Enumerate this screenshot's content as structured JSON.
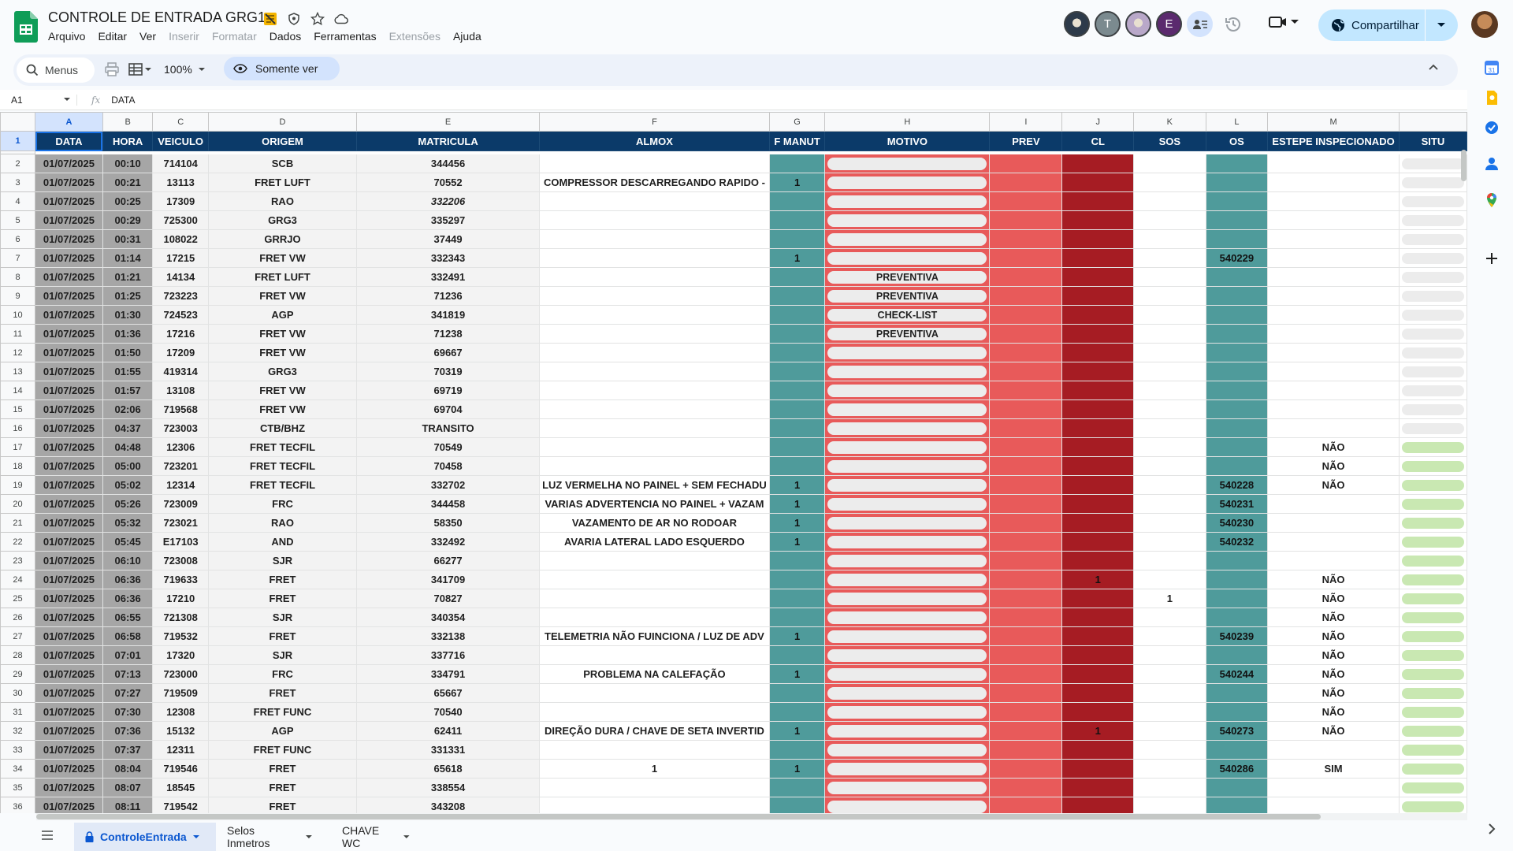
{
  "doc": {
    "title": "CONTROLE DE ENTRADA GRG1",
    "menus": [
      {
        "label": "Arquivo",
        "disabled": false
      },
      {
        "label": "Editar",
        "disabled": false
      },
      {
        "label": "Ver",
        "disabled": false
      },
      {
        "label": "Inserir",
        "disabled": true
      },
      {
        "label": "Formatar",
        "disabled": true
      },
      {
        "label": "Dados",
        "disabled": false
      },
      {
        "label": "Ferramentas",
        "disabled": false
      },
      {
        "label": "Extensões",
        "disabled": true
      },
      {
        "label": "Ajuda",
        "disabled": false
      }
    ]
  },
  "collaborators": [
    {
      "initial": "",
      "color": "#2d3a4a",
      "icon": "photo"
    },
    {
      "initial": "T",
      "color": "#7b8a8f",
      "icon": "letter"
    },
    {
      "initial": "",
      "color": "#b9a8c9",
      "icon": "photo"
    },
    {
      "initial": "E",
      "color": "#5b2a6e",
      "icon": "letter"
    },
    {
      "initial": "",
      "color": "#d3e3fd",
      "icon": "more"
    }
  ],
  "share": {
    "label": "Compartilhar"
  },
  "toolbar": {
    "search_label": "Menus",
    "zoom": "100%",
    "view_only_label": "Somente ver"
  },
  "formula": {
    "cell_ref": "A1",
    "fx": "fx",
    "content": "DATA"
  },
  "columns": [
    "A",
    "B",
    "C",
    "D",
    "E",
    "F",
    "G",
    "H",
    "I",
    "J",
    "K",
    "L",
    "M"
  ],
  "headers": [
    "DATA",
    "HORA",
    "VEICULO",
    "ORIGEM",
    "MATRICULA",
    "ALMOX",
    "F MANUT",
    "MOTIVO",
    "PREV",
    "CL",
    "SOS",
    "OS",
    "ESTEPE INSPECIONADO",
    "SITU"
  ],
  "rows": [
    {
      "n": "2",
      "data": "01/07/2025",
      "hora": "00:10",
      "veiculo": "714104",
      "origem": "SCB",
      "matricula": "344456",
      "almox": "",
      "fmanut": "",
      "motivo": "",
      "cl": "",
      "sos": "",
      "os": "",
      "estepe": "",
      "situ": "gray"
    },
    {
      "n": "3",
      "data": "01/07/2025",
      "hora": "00:21",
      "veiculo": "13113",
      "origem": "FRET LUFT",
      "matricula": "70552",
      "almox": "COMPRESSOR DESCARREGANDO RAPIDO -",
      "fmanut": "1",
      "motivo": "",
      "cl": "",
      "sos": "",
      "os": "",
      "estepe": "",
      "situ": "gray"
    },
    {
      "n": "4",
      "data": "01/07/2025",
      "hora": "00:25",
      "veiculo": "17309",
      "origem": "RAO",
      "matricula": "332206",
      "almox": "",
      "fmanut": "",
      "motivo": "",
      "cl": "",
      "sos": "",
      "os": "",
      "estepe": "",
      "situ": "gray",
      "italic": true
    },
    {
      "n": "5",
      "data": "01/07/2025",
      "hora": "00:29",
      "veiculo": "725300",
      "origem": "GRG3",
      "matricula": "335297",
      "almox": "",
      "fmanut": "",
      "motivo": "",
      "cl": "",
      "sos": "",
      "os": "",
      "estepe": "",
      "situ": "gray"
    },
    {
      "n": "6",
      "data": "01/07/2025",
      "hora": "00:31",
      "veiculo": "108022",
      "origem": "GRRJO",
      "matricula": "37449",
      "almox": "",
      "fmanut": "",
      "motivo": "",
      "cl": "",
      "sos": "",
      "os": "",
      "estepe": "",
      "situ": "gray"
    },
    {
      "n": "7",
      "data": "01/07/2025",
      "hora": "01:14",
      "veiculo": "17215",
      "origem": "FRET VW",
      "matricula": "332343",
      "almox": "",
      "fmanut": "1",
      "motivo": "",
      "cl": "",
      "sos": "",
      "os": "540229",
      "estepe": "",
      "situ": "gray"
    },
    {
      "n": "8",
      "data": "01/07/2025",
      "hora": "01:21",
      "veiculo": "14134",
      "origem": "FRET LUFT",
      "matricula": "332491",
      "almox": "",
      "fmanut": "",
      "motivo": "PREVENTIVA",
      "cl": "",
      "sos": "",
      "os": "",
      "estepe": "",
      "situ": "gray"
    },
    {
      "n": "9",
      "data": "01/07/2025",
      "hora": "01:25",
      "veiculo": "723223",
      "origem": "FRET VW",
      "matricula": "71236",
      "almox": "",
      "fmanut": "",
      "motivo": "PREVENTIVA",
      "cl": "",
      "sos": "",
      "os": "",
      "estepe": "",
      "situ": "gray"
    },
    {
      "n": "10",
      "data": "01/07/2025",
      "hora": "01:30",
      "veiculo": "724523",
      "origem": "AGP",
      "matricula": "341819",
      "almox": "",
      "fmanut": "",
      "motivo": "CHECK-LIST",
      "cl": "",
      "sos": "",
      "os": "",
      "estepe": "",
      "situ": "gray"
    },
    {
      "n": "11",
      "data": "01/07/2025",
      "hora": "01:36",
      "veiculo": "17216",
      "origem": "FRET VW",
      "matricula": "71238",
      "almox": "",
      "fmanut": "",
      "motivo": "PREVENTIVA",
      "cl": "",
      "sos": "",
      "os": "",
      "estepe": "",
      "situ": "gray"
    },
    {
      "n": "12",
      "data": "01/07/2025",
      "hora": "01:50",
      "veiculo": "17209",
      "origem": "FRET VW",
      "matricula": "69667",
      "almox": "",
      "fmanut": "",
      "motivo": "",
      "cl": "",
      "sos": "",
      "os": "",
      "estepe": "",
      "situ": "gray"
    },
    {
      "n": "13",
      "data": "01/07/2025",
      "hora": "01:55",
      "veiculo": "419314",
      "origem": "GRG3",
      "matricula": "70319",
      "almox": "",
      "fmanut": "",
      "motivo": "",
      "cl": "",
      "sos": "",
      "os": "",
      "estepe": "",
      "situ": "gray"
    },
    {
      "n": "14",
      "data": "01/07/2025",
      "hora": "01:57",
      "veiculo": "13108",
      "origem": "FRET VW",
      "matricula": "69719",
      "almox": "",
      "fmanut": "",
      "motivo": "",
      "cl": "",
      "sos": "",
      "os": "",
      "estepe": "",
      "situ": "gray"
    },
    {
      "n": "15",
      "data": "01/07/2025",
      "hora": "02:06",
      "veiculo": "719568",
      "origem": "FRET VW",
      "matricula": "69704",
      "almox": "",
      "fmanut": "",
      "motivo": "",
      "cl": "",
      "sos": "",
      "os": "",
      "estepe": "",
      "situ": "gray"
    },
    {
      "n": "16",
      "data": "01/07/2025",
      "hora": "04:37",
      "veiculo": "723003",
      "origem": "CTB/BHZ",
      "matricula": "TRANSITO",
      "almox": "",
      "fmanut": "",
      "motivo": "",
      "cl": "",
      "sos": "",
      "os": "",
      "estepe": "",
      "situ": "gray"
    },
    {
      "n": "17",
      "data": "01/07/2025",
      "hora": "04:48",
      "veiculo": "12306",
      "origem": "FRET TECFIL",
      "matricula": "70549",
      "almox": "",
      "fmanut": "",
      "motivo": "",
      "cl": "",
      "sos": "",
      "os": "",
      "estepe": "NÃO",
      "situ": "green"
    },
    {
      "n": "18",
      "data": "01/07/2025",
      "hora": "05:00",
      "veiculo": "723201",
      "origem": "FRET TECFIL",
      "matricula": "70458",
      "almox": "",
      "fmanut": "",
      "motivo": "",
      "cl": "",
      "sos": "",
      "os": "",
      "estepe": "NÃO",
      "situ": "green"
    },
    {
      "n": "19",
      "data": "01/07/2025",
      "hora": "05:02",
      "veiculo": "12314",
      "origem": "FRET TECFIL",
      "matricula": "332702",
      "almox": "LUZ VERMELHA NO PAINEL + SEM FECHADU",
      "fmanut": "1",
      "motivo": "",
      "cl": "",
      "sos": "",
      "os": "540228",
      "estepe": "NÃO",
      "situ": "green"
    },
    {
      "n": "20",
      "data": "01/07/2025",
      "hora": "05:26",
      "veiculo": "723009",
      "origem": "FRC",
      "matricula": "344458",
      "almox": "VARIAS ADVERTENCIA NO PAINEL + VAZAM",
      "fmanut": "1",
      "motivo": "",
      "cl": "",
      "sos": "",
      "os": "540231",
      "estepe": "",
      "situ": "green"
    },
    {
      "n": "21",
      "data": "01/07/2025",
      "hora": "05:32",
      "veiculo": "723021",
      "origem": "RAO",
      "matricula": "58350",
      "almox": "VAZAMENTO DE AR NO RODOAR",
      "fmanut": "1",
      "motivo": "",
      "cl": "",
      "sos": "",
      "os": "540230",
      "estepe": "",
      "situ": "green"
    },
    {
      "n": "22",
      "data": "01/07/2025",
      "hora": "05:45",
      "veiculo": "E17103",
      "origem": "AND",
      "matricula": "332492",
      "almox": "AVARIA LATERAL LADO ESQUERDO",
      "fmanut": "1",
      "motivo": "",
      "cl": "",
      "sos": "",
      "os": "540232",
      "estepe": "",
      "situ": "green"
    },
    {
      "n": "23",
      "data": "01/07/2025",
      "hora": "06:10",
      "veiculo": "723008",
      "origem": "SJR",
      "matricula": "66277",
      "almox": "",
      "fmanut": "",
      "motivo": "",
      "cl": "",
      "sos": "",
      "os": "",
      "estepe": "",
      "situ": "green"
    },
    {
      "n": "24",
      "data": "01/07/2025",
      "hora": "06:36",
      "veiculo": "719633",
      "origem": "FRET",
      "matricula": "341709",
      "almox": "",
      "fmanut": "",
      "motivo": "",
      "cl": "1",
      "sos": "",
      "os": "",
      "estepe": "NÃO",
      "situ": "green"
    },
    {
      "n": "25",
      "data": "01/07/2025",
      "hora": "06:36",
      "veiculo": "17210",
      "origem": "FRET",
      "matricula": "70827",
      "almox": "",
      "fmanut": "",
      "motivo": "",
      "cl": "",
      "sos": "1",
      "os": "",
      "estepe": "NÃO",
      "situ": "green"
    },
    {
      "n": "26",
      "data": "01/07/2025",
      "hora": "06:55",
      "veiculo": "721308",
      "origem": "SJR",
      "matricula": "340354",
      "almox": "",
      "fmanut": "",
      "motivo": "",
      "cl": "",
      "sos": "",
      "os": "",
      "estepe": "NÃO",
      "situ": "green"
    },
    {
      "n": "27",
      "data": "01/07/2025",
      "hora": "06:58",
      "veiculo": "719532",
      "origem": "FRET",
      "matricula": "332138",
      "almox": "TELEMETRIA NÃO FUINCIONA / LUZ DE ADV",
      "fmanut": "1",
      "motivo": "",
      "cl": "",
      "sos": "",
      "os": "540239",
      "estepe": "NÃO",
      "situ": "green"
    },
    {
      "n": "28",
      "data": "01/07/2025",
      "hora": "07:01",
      "veiculo": "17320",
      "origem": "SJR",
      "matricula": "337716",
      "almox": "",
      "fmanut": "",
      "motivo": "",
      "cl": "",
      "sos": "",
      "os": "",
      "estepe": "NÃO",
      "situ": "green"
    },
    {
      "n": "29",
      "data": "01/07/2025",
      "hora": "07:13",
      "veiculo": "723000",
      "origem": "FRC",
      "matricula": "334791",
      "almox": "PROBLEMA NA CALEFAÇÃO",
      "fmanut": "1",
      "motivo": "",
      "cl": "",
      "sos": "",
      "os": "540244",
      "estepe": "NÃO",
      "situ": "green"
    },
    {
      "n": "30",
      "data": "01/07/2025",
      "hora": "07:27",
      "veiculo": "719509",
      "origem": "FRET",
      "matricula": "65667",
      "almox": "",
      "fmanut": "",
      "motivo": "",
      "cl": "",
      "sos": "",
      "os": "",
      "estepe": "NÃO",
      "situ": "green"
    },
    {
      "n": "31",
      "data": "01/07/2025",
      "hora": "07:30",
      "veiculo": "12308",
      "origem": "FRET FUNC",
      "matricula": "70540",
      "almox": "",
      "fmanut": "",
      "motivo": "",
      "cl": "",
      "sos": "",
      "os": "",
      "estepe": "NÃO",
      "situ": "green"
    },
    {
      "n": "32",
      "data": "01/07/2025",
      "hora": "07:36",
      "veiculo": "15132",
      "origem": "AGP",
      "matricula": "62411",
      "almox": "DIREÇÃO DURA / CHAVE DE SETA INVERTID",
      "fmanut": "1",
      "motivo": "",
      "cl": "1",
      "sos": "",
      "os": "540273",
      "estepe": "NÃO",
      "situ": "green"
    },
    {
      "n": "33",
      "data": "01/07/2025",
      "hora": "07:37",
      "veiculo": "12311",
      "origem": "FRET FUNC",
      "matricula": "331331",
      "almox": "",
      "fmanut": "",
      "motivo": "",
      "cl": "",
      "sos": "",
      "os": "",
      "estepe": "",
      "situ": "green"
    },
    {
      "n": "34",
      "data": "01/07/2025",
      "hora": "08:04",
      "veiculo": "719546",
      "origem": "FRET",
      "matricula": "65618",
      "almox": "1",
      "fmanut": "1",
      "motivo": "",
      "cl": "",
      "sos": "",
      "os": "540286",
      "estepe": "SIM",
      "situ": "green"
    },
    {
      "n": "35",
      "data": "01/07/2025",
      "hora": "08:07",
      "veiculo": "18545",
      "origem": "FRET",
      "matricula": "338554",
      "almox": "",
      "fmanut": "",
      "motivo": "",
      "cl": "",
      "sos": "",
      "os": "",
      "estepe": "",
      "situ": "green"
    },
    {
      "n": "36",
      "data": "01/07/2025",
      "hora": "08:11",
      "veiculo": "719542",
      "origem": "FRET",
      "matricula": "343208",
      "almox": "",
      "fmanut": "",
      "motivo": "",
      "cl": "",
      "sos": "",
      "os": "",
      "estepe": "",
      "situ": "green"
    }
  ],
  "sheet_tabs": [
    {
      "label": "ControleEntrada",
      "active": true,
      "locked": true
    },
    {
      "label": "Selos Inmetros",
      "active": false,
      "locked": false
    },
    {
      "label": "CHAVE WC",
      "active": false,
      "locked": false
    }
  ],
  "colors": {
    "header_bg": "#0b3a69",
    "teal": "#4f9b9b",
    "red": "#e85a5a",
    "dark_red": "#a61c23",
    "gray_col": "#a6a6a6",
    "share_bg": "#c2e7ff",
    "accent": "#0b57d0"
  }
}
